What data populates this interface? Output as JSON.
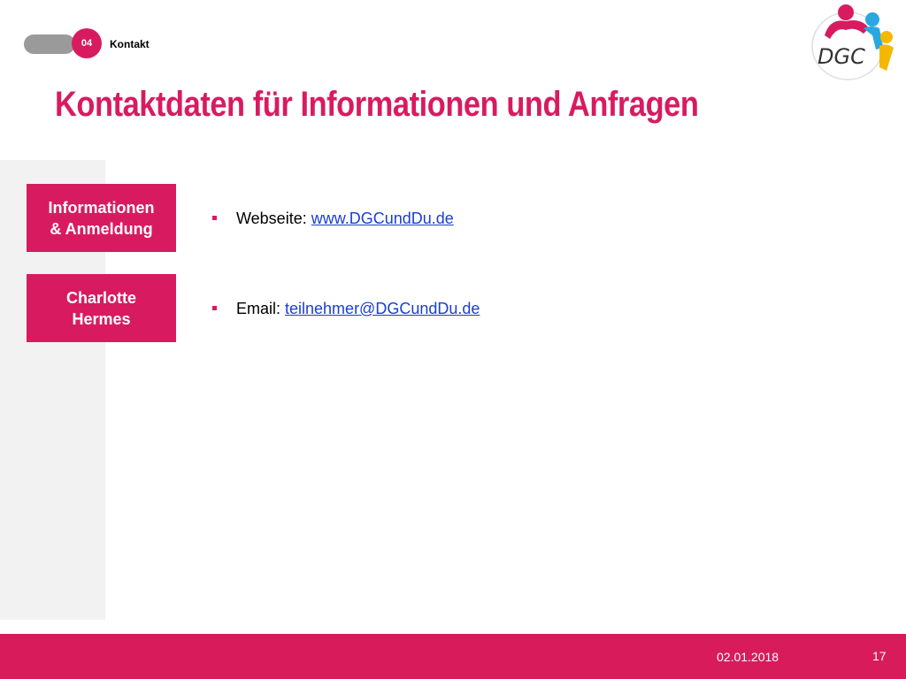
{
  "header": {
    "section_number": "04",
    "section_label": "Kontakt",
    "title": "Kontaktdaten für Informationen und Anfragen"
  },
  "logo": {
    "text": "DGC",
    "colors": [
      "#d81b60",
      "#29a8e0",
      "#f5b800"
    ]
  },
  "sidebar": {
    "items": [
      {
        "line1": "Informationen",
        "line2": "& Anmeldung"
      },
      {
        "line1": "Charlotte",
        "line2": "Hermes"
      }
    ]
  },
  "contacts": [
    {
      "label": "Webseite: ",
      "link": "www.DGCundDu.de"
    },
    {
      "label": "Email: ",
      "link": "teilnehmer@DGCundDu.de"
    }
  ],
  "footer": {
    "date": "02.01.2018",
    "page_number": "17"
  },
  "colors": {
    "accent": "#d81b60",
    "link": "#1a3fcf",
    "panel": "#f2f2f2"
  }
}
